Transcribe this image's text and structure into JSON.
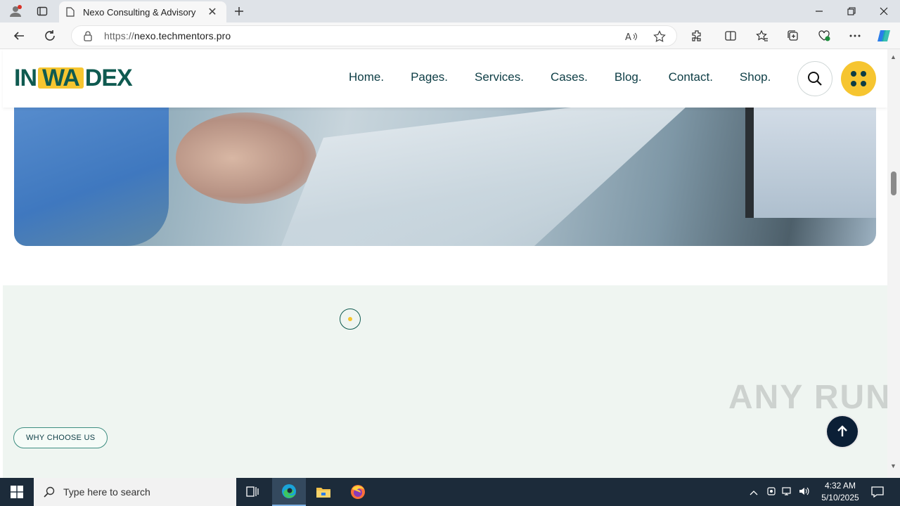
{
  "browser": {
    "tab_title": "Nexo Consulting & Advisory",
    "url_scheme": "https://",
    "url_host": "nexo.techmentors.pro"
  },
  "site": {
    "logo_left": "IN",
    "logo_mid": "WA",
    "logo_right": "DEX",
    "menu": [
      "Home.",
      "Pages.",
      "Services.",
      "Cases.",
      "Blog.",
      "Contact.",
      "Shop."
    ]
  },
  "section": {
    "badge": "WHY CHOOSE US"
  },
  "watermark": "ANY RUN",
  "taskbar": {
    "search_placeholder": "Type here to search",
    "time": "4:32 AM",
    "date": "5/10/2025"
  },
  "colors": {
    "brand_green": "#0f5a50",
    "brand_yellow": "#f6c530",
    "section_bg": "#eff5f1",
    "taskbar_bg": "#1c2b3a"
  }
}
